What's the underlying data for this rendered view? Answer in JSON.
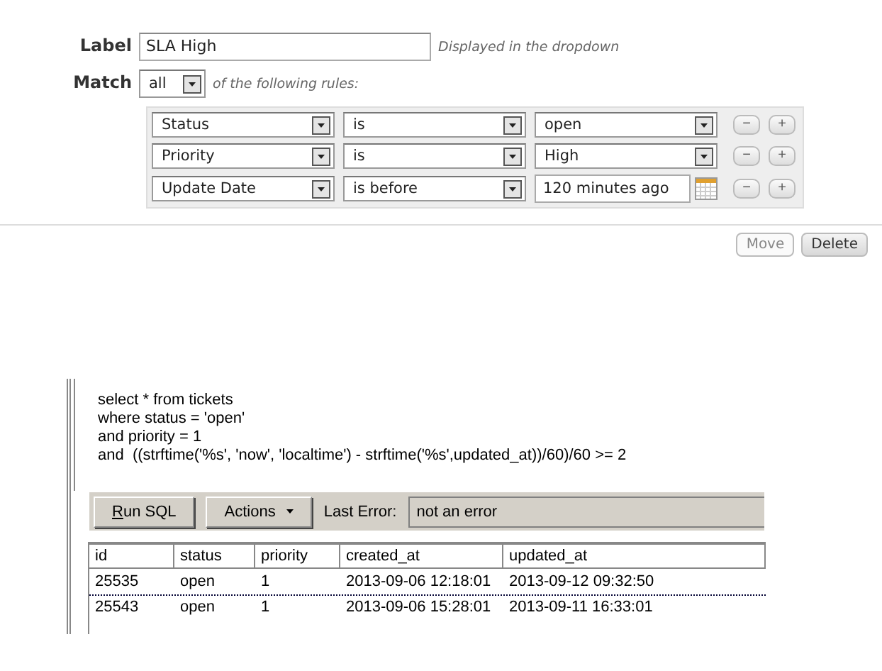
{
  "form": {
    "label": {
      "caption": "Label",
      "value": "SLA High",
      "hint": "Displayed in the dropdown"
    },
    "match": {
      "caption": "Match",
      "value": "all",
      "suffix": "of the following rules:"
    },
    "rules": [
      {
        "field": "Status",
        "operator": "is",
        "value": "open",
        "kind": "select"
      },
      {
        "field": "Priority",
        "operator": "is",
        "value": "High",
        "kind": "select"
      },
      {
        "field": "Update Date",
        "operator": "is before",
        "value": "120 minutes ago",
        "kind": "date"
      }
    ],
    "remove_label": "−",
    "add_label": "+",
    "actions": [
      {
        "label": "Move",
        "disabled": true
      },
      {
        "label": "Delete",
        "disabled": false
      }
    ]
  },
  "sql": {
    "query": [
      "select * from tickets",
      "where status = 'open'",
      "and priority = 1",
      "and  ((strftime('%s', 'now', 'localtime') - strftime('%s',updated_at))/60)/60 >= 2"
    ],
    "run_button": "Run SQL",
    "actions_button": "Actions",
    "error_label": "Last Error:",
    "error_value": "not an error",
    "columns": [
      "id",
      "status",
      "priority",
      "created_at",
      "updated_at"
    ],
    "rows": [
      {
        "selected": true,
        "cells": [
          "25535",
          "open",
          "1",
          "2013-09-06 12:18:01",
          "2013-09-12 09:32:50"
        ]
      },
      {
        "selected": false,
        "cells": [
          "25543",
          "open",
          "1",
          "2013-09-06 15:28:01",
          "2013-09-11 16:33:01"
        ]
      }
    ]
  }
}
